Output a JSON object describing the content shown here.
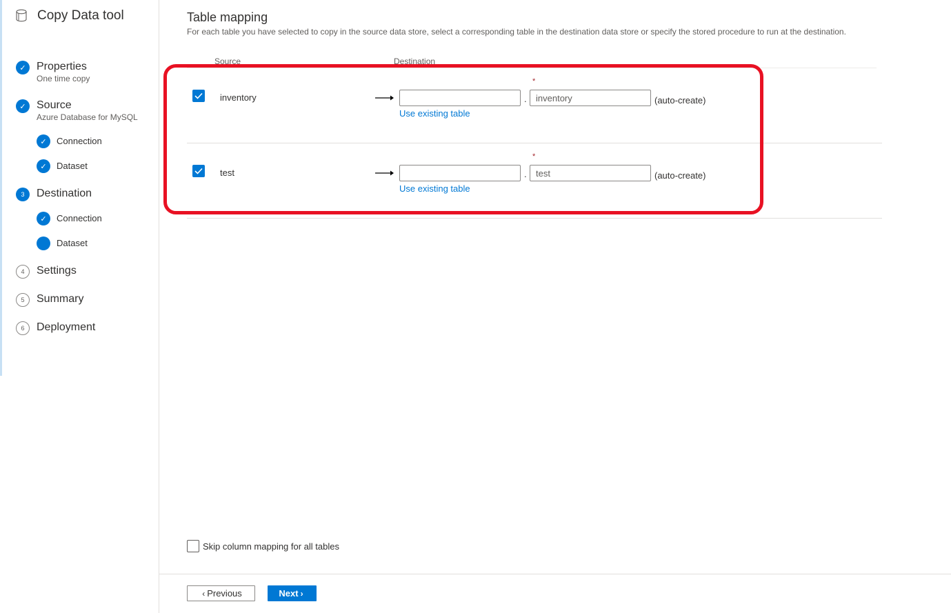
{
  "app": {
    "title": "Copy Data tool",
    "icon": "database-icon"
  },
  "steps": [
    {
      "id": "properties",
      "label": "Properties",
      "sub": "One time copy",
      "state": "done",
      "marker": "✓"
    },
    {
      "id": "source",
      "label": "Source",
      "sub": "Azure Database for MySQL",
      "state": "done",
      "marker": "✓",
      "children": [
        {
          "label": "Connection",
          "state": "done",
          "marker": "✓"
        },
        {
          "label": "Dataset",
          "state": "done",
          "marker": "✓"
        }
      ]
    },
    {
      "id": "destination",
      "label": "Destination",
      "state": "current",
      "marker": "3",
      "children": [
        {
          "label": "Connection",
          "state": "done",
          "marker": "✓"
        },
        {
          "label": "Dataset",
          "state": "current",
          "marker": ""
        }
      ]
    },
    {
      "id": "settings",
      "label": "Settings",
      "state": "todo",
      "marker": "4"
    },
    {
      "id": "summary",
      "label": "Summary",
      "state": "todo",
      "marker": "5"
    },
    {
      "id": "deployment",
      "label": "Deployment",
      "state": "todo",
      "marker": "6"
    }
  ],
  "main": {
    "title": "Table mapping",
    "description": "For each table you have selected to copy in the source data store, select a corresponding table in the destination data store or specify the stored procedure to run at the destination.",
    "columns": {
      "source": "Source",
      "destination": "Destination"
    },
    "rows": [
      {
        "checked": true,
        "source": "inventory",
        "schema_value": "",
        "table_value": "inventory",
        "required_mark": "*",
        "separator": ".",
        "auto_create": "(auto-create)",
        "link": "Use existing table"
      },
      {
        "checked": true,
        "source": "test",
        "schema_value": "",
        "table_value": "test",
        "required_mark": "*",
        "separator": ".",
        "auto_create": "(auto-create)",
        "link": "Use existing table"
      }
    ],
    "skip_mapping": {
      "label": "Skip column mapping for all tables",
      "checked": false
    }
  },
  "footer": {
    "previous": "Previous",
    "next": "Next"
  },
  "colors": {
    "accent": "#0078d4",
    "highlight": "#e81123",
    "required": "#a4262c"
  }
}
